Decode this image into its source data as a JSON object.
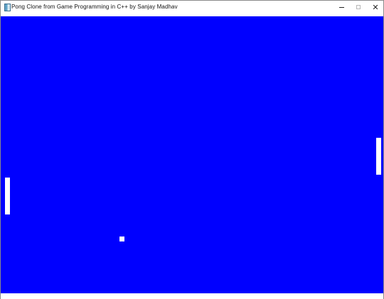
{
  "window": {
    "title": "Pong Clone from Game Programming in C++ by Sanjay Madhav",
    "icon": "app-window-icon",
    "controls": {
      "minimize_icon": "minimize-icon",
      "maximize_icon": "maximize-icon",
      "close_icon": "close-icon",
      "close_glyph": "✕"
    }
  },
  "game": {
    "background_color": "#0000ff",
    "object_color": "#ffffff"
  }
}
